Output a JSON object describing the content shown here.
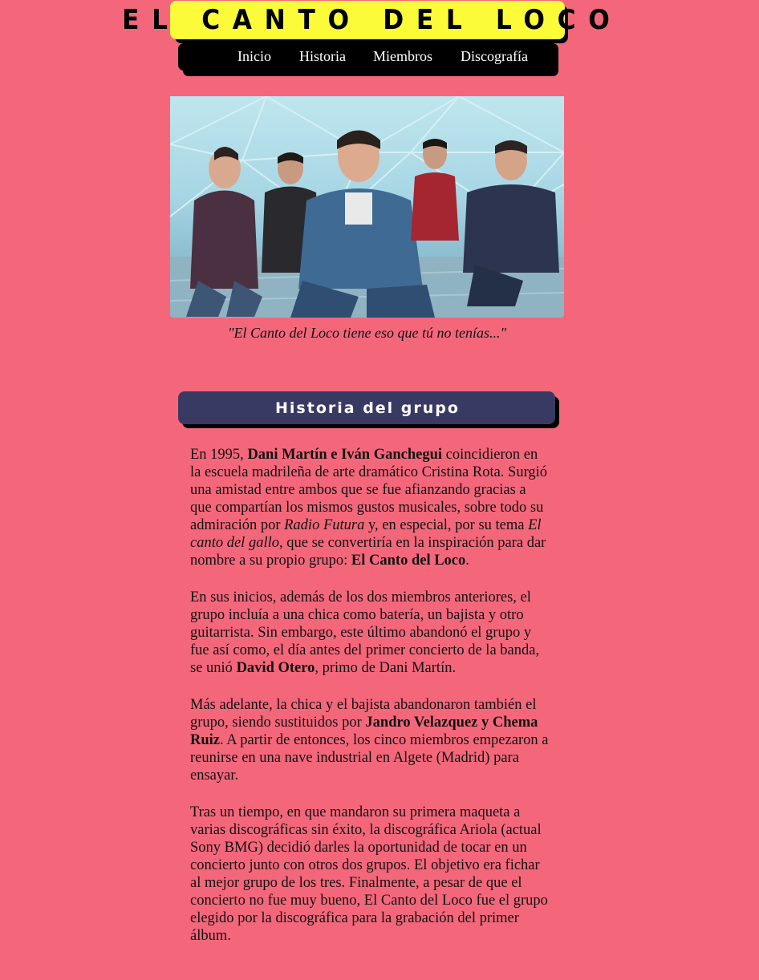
{
  "logo": {
    "text": "EL CANTO DEL LOCO"
  },
  "nav": {
    "items": [
      {
        "label": "Inicio"
      },
      {
        "label": "Historia"
      },
      {
        "label": "Miembros"
      },
      {
        "label": "Discografía"
      }
    ]
  },
  "hero": {
    "image": "band-photo"
  },
  "caption": "\"El Canto del Loco tiene eso que tú no tenías...\"",
  "section": {
    "title": "Historia del grupo",
    "p1": {
      "t1": "En 1995, ",
      "b1": "Dani Martín e Iván Ganchegui",
      "t2": " coincidieron en la escuela madrileña de arte dramático Cristina Rota. Surgió una amistad entre ambos que se fue afianzando gracias a que compartían los mismos gustos musicales, sobre todo su admiración por ",
      "i1": "Radio Futura",
      "t3": " y, en especial, por su tema ",
      "i2": "El canto del gallo",
      "t4": ", que se convertiría en la inspiración para dar nombre a su propio grupo: ",
      "b2": "El Canto del Loco",
      "t5": "."
    },
    "p2": {
      "t1": "En sus inicios, además de los dos miembros anteriores, el grupo incluía a una chica como batería, un bajista y otro guitarrista. Sin embargo, este último abandonó el grupo y fue así como, el día antes del primer concierto de la banda, se unió ",
      "b1": "David Otero",
      "t2": ", primo de Dani Martín."
    },
    "p3": {
      "t1": "Más adelante, la chica y el bajista abandonaron también el grupo, siendo sustituidos por ",
      "b1": "Jandro Velazquez y Chema Ruiz",
      "t2": ". A partir de entonces, los cinco miembros empezaron a reunirse en una nave industrial en Algete (Madrid) para ensayar."
    },
    "p4": {
      "t1": "Tras un tiempo, en que mandaron su primera maqueta a varias discográficas sin éxito, la discográfica Ariola (actual Sony BMG) decidió darles la oportunidad de tocar en un concierto junto con otros dos grupos. El objetivo era fichar al mejor grupo de los tres. Finalmente, a pesar de que el concierto no fue muy bueno, El Canto del Loco fue el grupo elegido por la discográfica para la grabación del primer álbum."
    }
  },
  "colors": {
    "background": "#f4677b",
    "logo_bg": "#fbfb3a",
    "nav_bg": "#000000",
    "section_header_bg": "#393a63"
  }
}
